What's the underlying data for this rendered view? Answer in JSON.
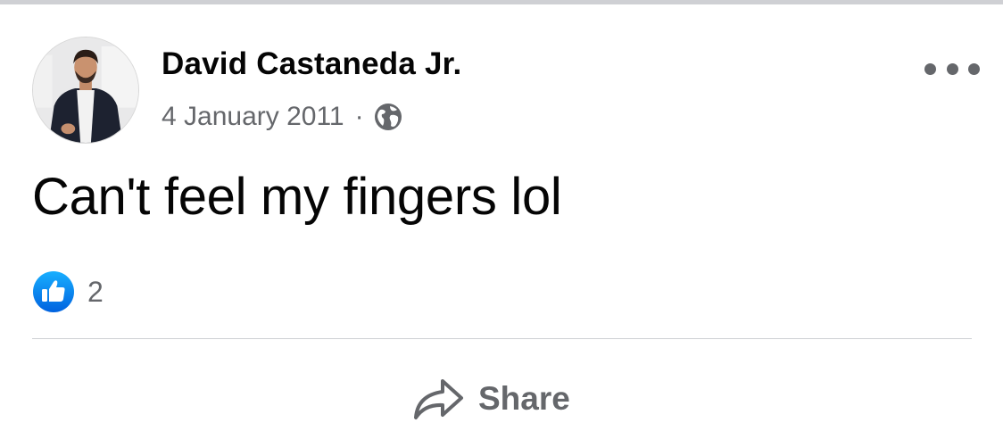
{
  "post": {
    "author": "David Castaneda Jr.",
    "date": "4 January 2011",
    "separator": "·",
    "privacy_icon": "globe-icon",
    "text": "Can't feel my fingers lol",
    "more_icon": "more-options-icon",
    "reactions": {
      "icon": "like-icon",
      "count": "2"
    },
    "actions": {
      "share_label": "Share",
      "share_icon": "share-arrow-icon"
    }
  },
  "colors": {
    "primary_text": "#050505",
    "secondary_text": "#65676b",
    "like_blue": "#1877f2",
    "divider": "#ced0d4"
  }
}
